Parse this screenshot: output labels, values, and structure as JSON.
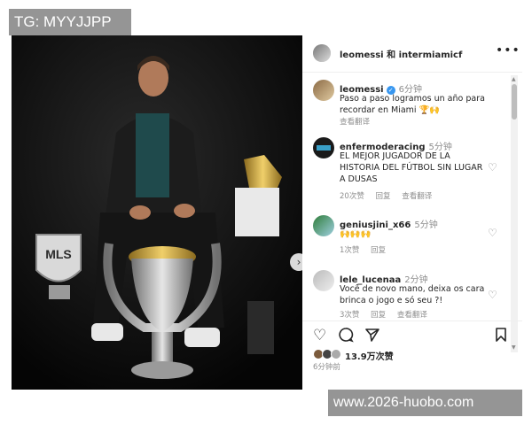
{
  "watermarks": {
    "top_left": "TG: MYYJJPP",
    "bottom_right": "www.2026-huobo.com"
  },
  "post": {
    "header": {
      "title": "leomessi 和 intermiamicf",
      "more_icon": "more-horizontal-icon"
    },
    "caption": {
      "username": "leomessi",
      "time": "6分钟",
      "text": "Paso a paso logramos un año para recordar en Miami 🏆🙌",
      "translate": "查看翻译"
    },
    "comments": [
      {
        "username": "enfermoderacing",
        "time": "5分钟",
        "text": "EL MEJOR JUGADOR DE LA HISTORIA DEL FÚTBOL SIN LUGAR A DUSAS",
        "likes": "20次赞",
        "reply": "回复",
        "translate": "查看翻译"
      },
      {
        "username": "geniusjini_x66",
        "time": "5分钟",
        "text": "🙌🙌🙌",
        "likes": "1次赞",
        "reply": "回复"
      },
      {
        "username": "lele_lucenaa",
        "time": "2分钟",
        "text": "Você de novo mano, deixa os cara brinca o jogo e só seu ?!",
        "likes": "3次赞",
        "reply": "回复",
        "translate": "查看翻译"
      }
    ],
    "like_count": "13.9万次赞",
    "posted_time": "6分钟前",
    "photo_label": "MLS"
  },
  "colors": {
    "verified": "#3897f0",
    "text": "#262626",
    "muted": "#8e8e8e"
  }
}
